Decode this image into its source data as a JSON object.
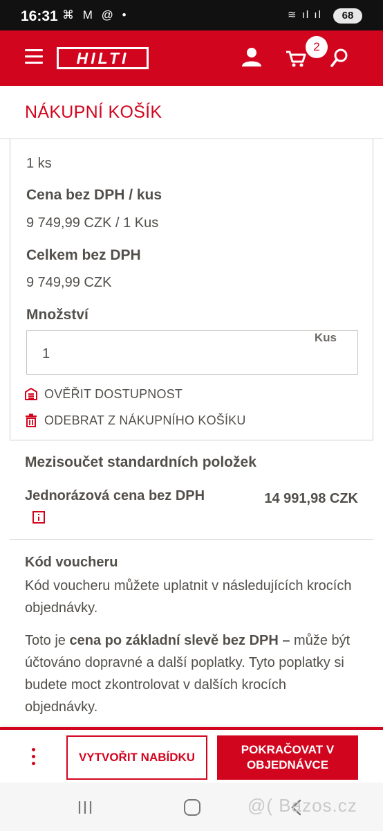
{
  "status_bar": {
    "time": "16:31",
    "notif_icons": "⌘ M @ •",
    "sys_icons": "≋ ıl ıl",
    "battery": "68"
  },
  "header": {
    "logo": "HILTI",
    "cart_count": "2",
    "brand_color": "#d2051e"
  },
  "page_title": "NÁKUPNÍ KOŠÍK",
  "item": {
    "quantity_text": "1 ks",
    "unit_price_label": "Cena bez DPH / kus",
    "unit_price_value": "9 749,99 CZK / 1 Kus",
    "total_label": "Celkem bez DPH",
    "total_value": "9 749,99 CZK",
    "qty_label": "Množství",
    "qty_unit": "Kus",
    "qty_value": "1",
    "check_availability": "OVĚŘIT DOSTUPNOST",
    "remove_from_cart": "ODEBRAT Z NÁKUPNÍHO KOŠÍKU"
  },
  "summary": {
    "title": "Mezisoučet standardních položek",
    "one_time_label": "Jednorázová cena bez DPH",
    "one_time_value": "14 991,98 CZK"
  },
  "voucher": {
    "title": "Kód voucheru",
    "text": "Kód voucheru můžete uplatnit v následujících krocích objednávky."
  },
  "note": {
    "prefix": "Toto je ",
    "bold": "cena po základní slevě bez DPH –",
    "suffix": " může být účtováno dopravné a další poplatky. Tyto poplatky si budete moct zkontrolovat v dalších krocích objednávky."
  },
  "actions": {
    "create_quote": "VYTVOŘIT NABÍDKU",
    "continue_order": "POKRAČOVAT V OBJEDNÁVCE"
  },
  "watermark": "@( Bazos.cz"
}
